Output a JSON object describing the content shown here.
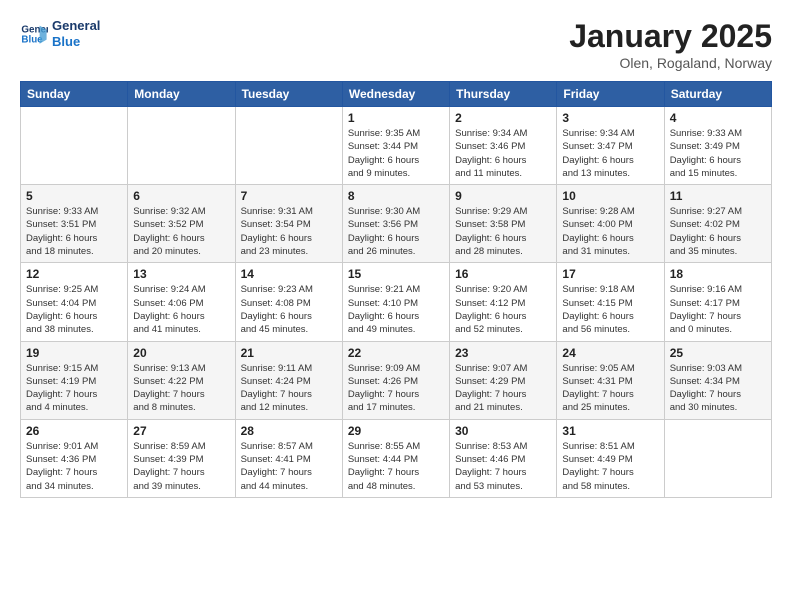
{
  "header": {
    "logo_line1": "General",
    "logo_line2": "Blue",
    "month_title": "January 2025",
    "location": "Olen, Rogaland, Norway"
  },
  "days_of_week": [
    "Sunday",
    "Monday",
    "Tuesday",
    "Wednesday",
    "Thursday",
    "Friday",
    "Saturday"
  ],
  "weeks": [
    [
      {
        "day": "",
        "info": ""
      },
      {
        "day": "",
        "info": ""
      },
      {
        "day": "",
        "info": ""
      },
      {
        "day": "1",
        "info": "Sunrise: 9:35 AM\nSunset: 3:44 PM\nDaylight: 6 hours\nand 9 minutes."
      },
      {
        "day": "2",
        "info": "Sunrise: 9:34 AM\nSunset: 3:46 PM\nDaylight: 6 hours\nand 11 minutes."
      },
      {
        "day": "3",
        "info": "Sunrise: 9:34 AM\nSunset: 3:47 PM\nDaylight: 6 hours\nand 13 minutes."
      },
      {
        "day": "4",
        "info": "Sunrise: 9:33 AM\nSunset: 3:49 PM\nDaylight: 6 hours\nand 15 minutes."
      }
    ],
    [
      {
        "day": "5",
        "info": "Sunrise: 9:33 AM\nSunset: 3:51 PM\nDaylight: 6 hours\nand 18 minutes."
      },
      {
        "day": "6",
        "info": "Sunrise: 9:32 AM\nSunset: 3:52 PM\nDaylight: 6 hours\nand 20 minutes."
      },
      {
        "day": "7",
        "info": "Sunrise: 9:31 AM\nSunset: 3:54 PM\nDaylight: 6 hours\nand 23 minutes."
      },
      {
        "day": "8",
        "info": "Sunrise: 9:30 AM\nSunset: 3:56 PM\nDaylight: 6 hours\nand 26 minutes."
      },
      {
        "day": "9",
        "info": "Sunrise: 9:29 AM\nSunset: 3:58 PM\nDaylight: 6 hours\nand 28 minutes."
      },
      {
        "day": "10",
        "info": "Sunrise: 9:28 AM\nSunset: 4:00 PM\nDaylight: 6 hours\nand 31 minutes."
      },
      {
        "day": "11",
        "info": "Sunrise: 9:27 AM\nSunset: 4:02 PM\nDaylight: 6 hours\nand 35 minutes."
      }
    ],
    [
      {
        "day": "12",
        "info": "Sunrise: 9:25 AM\nSunset: 4:04 PM\nDaylight: 6 hours\nand 38 minutes."
      },
      {
        "day": "13",
        "info": "Sunrise: 9:24 AM\nSunset: 4:06 PM\nDaylight: 6 hours\nand 41 minutes."
      },
      {
        "day": "14",
        "info": "Sunrise: 9:23 AM\nSunset: 4:08 PM\nDaylight: 6 hours\nand 45 minutes."
      },
      {
        "day": "15",
        "info": "Sunrise: 9:21 AM\nSunset: 4:10 PM\nDaylight: 6 hours\nand 49 minutes."
      },
      {
        "day": "16",
        "info": "Sunrise: 9:20 AM\nSunset: 4:12 PM\nDaylight: 6 hours\nand 52 minutes."
      },
      {
        "day": "17",
        "info": "Sunrise: 9:18 AM\nSunset: 4:15 PM\nDaylight: 6 hours\nand 56 minutes."
      },
      {
        "day": "18",
        "info": "Sunrise: 9:16 AM\nSunset: 4:17 PM\nDaylight: 7 hours\nand 0 minutes."
      }
    ],
    [
      {
        "day": "19",
        "info": "Sunrise: 9:15 AM\nSunset: 4:19 PM\nDaylight: 7 hours\nand 4 minutes."
      },
      {
        "day": "20",
        "info": "Sunrise: 9:13 AM\nSunset: 4:22 PM\nDaylight: 7 hours\nand 8 minutes."
      },
      {
        "day": "21",
        "info": "Sunrise: 9:11 AM\nSunset: 4:24 PM\nDaylight: 7 hours\nand 12 minutes."
      },
      {
        "day": "22",
        "info": "Sunrise: 9:09 AM\nSunset: 4:26 PM\nDaylight: 7 hours\nand 17 minutes."
      },
      {
        "day": "23",
        "info": "Sunrise: 9:07 AM\nSunset: 4:29 PM\nDaylight: 7 hours\nand 21 minutes."
      },
      {
        "day": "24",
        "info": "Sunrise: 9:05 AM\nSunset: 4:31 PM\nDaylight: 7 hours\nand 25 minutes."
      },
      {
        "day": "25",
        "info": "Sunrise: 9:03 AM\nSunset: 4:34 PM\nDaylight: 7 hours\nand 30 minutes."
      }
    ],
    [
      {
        "day": "26",
        "info": "Sunrise: 9:01 AM\nSunset: 4:36 PM\nDaylight: 7 hours\nand 34 minutes."
      },
      {
        "day": "27",
        "info": "Sunrise: 8:59 AM\nSunset: 4:39 PM\nDaylight: 7 hours\nand 39 minutes."
      },
      {
        "day": "28",
        "info": "Sunrise: 8:57 AM\nSunset: 4:41 PM\nDaylight: 7 hours\nand 44 minutes."
      },
      {
        "day": "29",
        "info": "Sunrise: 8:55 AM\nSunset: 4:44 PM\nDaylight: 7 hours\nand 48 minutes."
      },
      {
        "day": "30",
        "info": "Sunrise: 8:53 AM\nSunset: 4:46 PM\nDaylight: 7 hours\nand 53 minutes."
      },
      {
        "day": "31",
        "info": "Sunrise: 8:51 AM\nSunset: 4:49 PM\nDaylight: 7 hours\nand 58 minutes."
      },
      {
        "day": "",
        "info": ""
      }
    ]
  ]
}
